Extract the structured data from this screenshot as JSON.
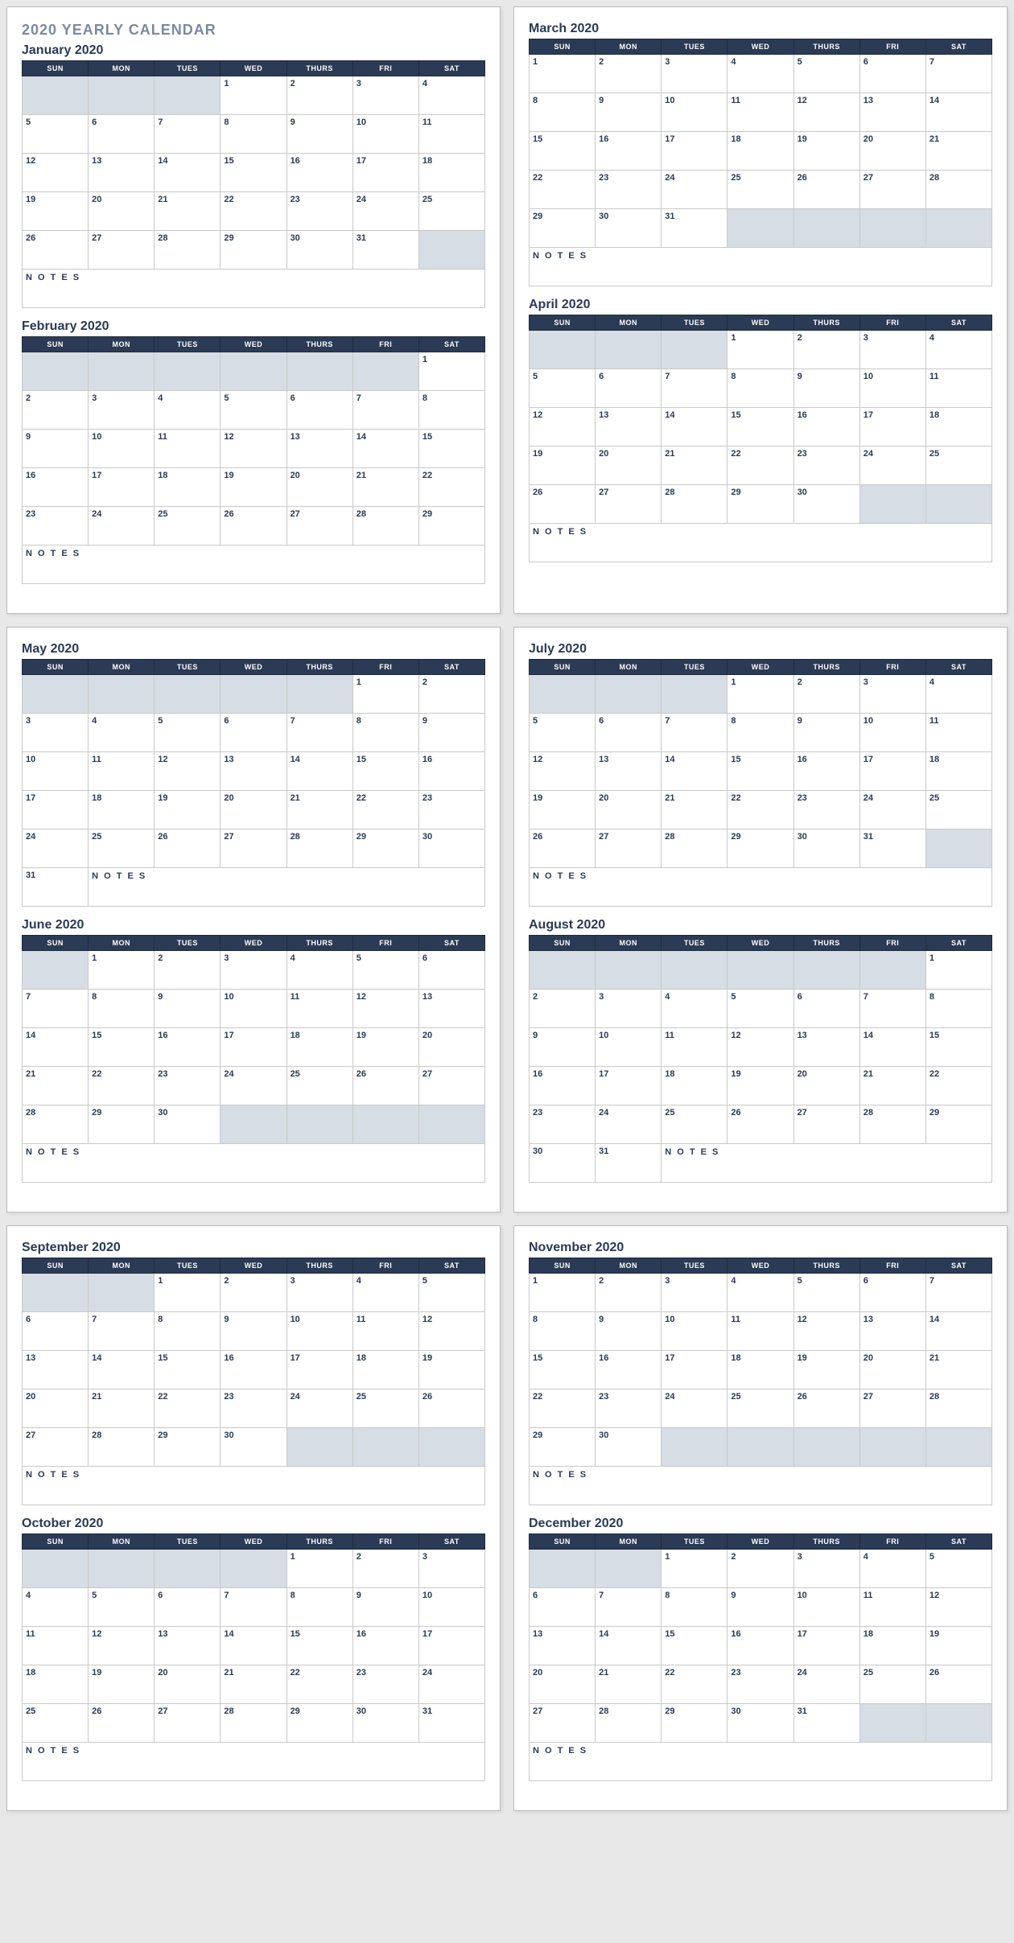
{
  "title": "2020 YEARLY CALENDAR",
  "days": [
    "SUN",
    "MON",
    "TUES",
    "WED",
    "THURS",
    "FRI",
    "SAT"
  ],
  "notes_label": "N O T E S",
  "sheets": [
    {
      "show_title": true,
      "months": [
        {
          "name": "January 2020",
          "grid": [
            [
              null,
              null,
              null,
              "1",
              "2",
              "3",
              "4"
            ],
            [
              "5",
              "6",
              "7",
              "8",
              "9",
              "10",
              "11"
            ],
            [
              "12",
              "13",
              "14",
              "15",
              "16",
              "17",
              "18"
            ],
            [
              "19",
              "20",
              "21",
              "22",
              "23",
              "24",
              "25"
            ],
            [
              "26",
              "27",
              "28",
              "29",
              "30",
              "31",
              null
            ]
          ],
          "notes_full": true
        },
        {
          "name": "February 2020",
          "grid": [
            [
              null,
              null,
              null,
              null,
              null,
              null,
              "1"
            ],
            [
              "2",
              "3",
              "4",
              "5",
              "6",
              "7",
              "8"
            ],
            [
              "9",
              "10",
              "11",
              "12",
              "13",
              "14",
              "15"
            ],
            [
              "16",
              "17",
              "18",
              "19",
              "20",
              "21",
              "22"
            ],
            [
              "23",
              "24",
              "25",
              "26",
              "27",
              "28",
              "29"
            ]
          ],
          "notes_full": true
        }
      ]
    },
    {
      "show_title": false,
      "months": [
        {
          "name": "March 2020",
          "grid": [
            [
              "1",
              "2",
              "3",
              "4",
              "5",
              "6",
              "7"
            ],
            [
              "8",
              "9",
              "10",
              "11",
              "12",
              "13",
              "14"
            ],
            [
              "15",
              "16",
              "17",
              "18",
              "19",
              "20",
              "21"
            ],
            [
              "22",
              "23",
              "24",
              "25",
              "26",
              "27",
              "28"
            ],
            [
              "29",
              "30",
              "31",
              null,
              null,
              null,
              null
            ]
          ],
          "notes_full": true
        },
        {
          "name": "April 2020",
          "grid": [
            [
              null,
              null,
              null,
              "1",
              "2",
              "3",
              "4"
            ],
            [
              "5",
              "6",
              "7",
              "8",
              "9",
              "10",
              "11"
            ],
            [
              "12",
              "13",
              "14",
              "15",
              "16",
              "17",
              "18"
            ],
            [
              "19",
              "20",
              "21",
              "22",
              "23",
              "24",
              "25"
            ],
            [
              "26",
              "27",
              "28",
              "29",
              "30",
              null,
              null
            ]
          ],
          "notes_full": true
        }
      ]
    },
    {
      "show_title": false,
      "months": [
        {
          "name": "May 2020",
          "grid": [
            [
              null,
              null,
              null,
              null,
              null,
              "1",
              "2"
            ],
            [
              "3",
              "4",
              "5",
              "6",
              "7",
              "8",
              "9"
            ],
            [
              "10",
              "11",
              "12",
              "13",
              "14",
              "15",
              "16"
            ],
            [
              "17",
              "18",
              "19",
              "20",
              "21",
              "22",
              "23"
            ],
            [
              "24",
              "25",
              "26",
              "27",
              "28",
              "29",
              "30"
            ]
          ],
          "notes_trailing": {
            "extra_days": [
              "31"
            ],
            "notes_span": 6
          }
        },
        {
          "name": "June 2020",
          "grid": [
            [
              null,
              "1",
              "2",
              "3",
              "4",
              "5",
              "6"
            ],
            [
              "7",
              "8",
              "9",
              "10",
              "11",
              "12",
              "13"
            ],
            [
              "14",
              "15",
              "16",
              "17",
              "18",
              "19",
              "20"
            ],
            [
              "21",
              "22",
              "23",
              "24",
              "25",
              "26",
              "27"
            ],
            [
              "28",
              "29",
              "30",
              null,
              null,
              null,
              null
            ]
          ],
          "notes_full": true
        }
      ]
    },
    {
      "show_title": false,
      "months": [
        {
          "name": "July 2020",
          "grid": [
            [
              null,
              null,
              null,
              "1",
              "2",
              "3",
              "4"
            ],
            [
              "5",
              "6",
              "7",
              "8",
              "9",
              "10",
              "11"
            ],
            [
              "12",
              "13",
              "14",
              "15",
              "16",
              "17",
              "18"
            ],
            [
              "19",
              "20",
              "21",
              "22",
              "23",
              "24",
              "25"
            ],
            [
              "26",
              "27",
              "28",
              "29",
              "30",
              "31",
              null
            ]
          ],
          "notes_full": true
        },
        {
          "name": "August 2020",
          "grid": [
            [
              null,
              null,
              null,
              null,
              null,
              null,
              "1"
            ],
            [
              "2",
              "3",
              "4",
              "5",
              "6",
              "7",
              "8"
            ],
            [
              "9",
              "10",
              "11",
              "12",
              "13",
              "14",
              "15"
            ],
            [
              "16",
              "17",
              "18",
              "19",
              "20",
              "21",
              "22"
            ],
            [
              "23",
              "24",
              "25",
              "26",
              "27",
              "28",
              "29"
            ]
          ],
          "notes_trailing": {
            "extra_days": [
              "30",
              "31"
            ],
            "notes_span": 5
          }
        }
      ]
    },
    {
      "show_title": false,
      "months": [
        {
          "name": "September 2020",
          "grid": [
            [
              null,
              null,
              "1",
              "2",
              "3",
              "4",
              "5"
            ],
            [
              "6",
              "7",
              "8",
              "9",
              "10",
              "11",
              "12"
            ],
            [
              "13",
              "14",
              "15",
              "16",
              "17",
              "18",
              "19"
            ],
            [
              "20",
              "21",
              "22",
              "23",
              "24",
              "25",
              "26"
            ],
            [
              "27",
              "28",
              "29",
              "30",
              null,
              null,
              null
            ]
          ],
          "notes_full": true
        },
        {
          "name": "October 2020",
          "grid": [
            [
              null,
              null,
              null,
              null,
              "1",
              "2",
              "3"
            ],
            [
              "4",
              "5",
              "6",
              "7",
              "8",
              "9",
              "10"
            ],
            [
              "11",
              "12",
              "13",
              "14",
              "15",
              "16",
              "17"
            ],
            [
              "18",
              "19",
              "20",
              "21",
              "22",
              "23",
              "24"
            ],
            [
              "25",
              "26",
              "27",
              "28",
              "29",
              "30",
              "31"
            ]
          ],
          "notes_full": true
        }
      ]
    },
    {
      "show_title": false,
      "months": [
        {
          "name": "November 2020",
          "grid": [
            [
              "1",
              "2",
              "3",
              "4",
              "5",
              "6",
              "7"
            ],
            [
              "8",
              "9",
              "10",
              "11",
              "12",
              "13",
              "14"
            ],
            [
              "15",
              "16",
              "17",
              "18",
              "19",
              "20",
              "21"
            ],
            [
              "22",
              "23",
              "24",
              "25",
              "26",
              "27",
              "28"
            ],
            [
              "29",
              "30",
              null,
              null,
              null,
              null,
              null
            ]
          ],
          "notes_full": true
        },
        {
          "name": "December 2020",
          "grid": [
            [
              null,
              null,
              "1",
              "2",
              "3",
              "4",
              "5"
            ],
            [
              "6",
              "7",
              "8",
              "9",
              "10",
              "11",
              "12"
            ],
            [
              "13",
              "14",
              "15",
              "16",
              "17",
              "18",
              "19"
            ],
            [
              "20",
              "21",
              "22",
              "23",
              "24",
              "25",
              "26"
            ],
            [
              "27",
              "28",
              "29",
              "30",
              "31",
              null,
              null
            ]
          ],
          "notes_full": true
        }
      ]
    }
  ]
}
